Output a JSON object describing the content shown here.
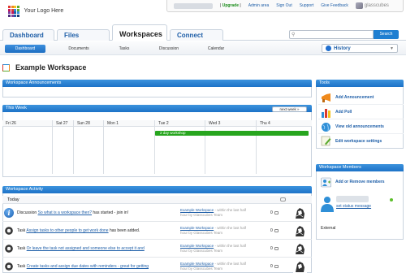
{
  "header": {
    "logo_text": "Your Logo Here",
    "upgrade_label": "Upgrade",
    "links": [
      "Admin area",
      "Sign Out",
      "Support",
      "Give Feedback"
    ],
    "brand": "glasscubes"
  },
  "tabs": [
    {
      "label": "Dashboard",
      "active": false
    },
    {
      "label": "Files",
      "active": false
    },
    {
      "label": "Workspaces",
      "active": true
    },
    {
      "label": "Connect",
      "active": false
    }
  ],
  "search": {
    "placeholder": "",
    "button_label": "Search"
  },
  "subnav": {
    "items": [
      {
        "label": "Dashboard",
        "active": true
      },
      {
        "label": "Documents",
        "active": false
      },
      {
        "label": "Tasks",
        "active": false
      },
      {
        "label": "Discussion",
        "active": false
      },
      {
        "label": "Calendar",
        "active": false
      }
    ],
    "history_label": "History"
  },
  "workspace": {
    "title": "Example Workspace"
  },
  "announcements": {
    "heading": "Workspace Announcements"
  },
  "this_week": {
    "heading": "This Week",
    "next_label": "next week »",
    "days": [
      "Fri 26",
      "Sat 27",
      "Sun 28",
      "Mon 1",
      "Tue 2",
      "Wed 3",
      "Thu 4"
    ],
    "event": "2 day workshop"
  },
  "activity": {
    "heading": "Workspace Activity",
    "group_label": "Today",
    "items": [
      {
        "icon": "info-icon",
        "type": "Discussion",
        "link": "So what is a workspace then?",
        "suffix": "has started - join in!",
        "source": "Example Workspace",
        "when": "- within the last half",
        "by": "hour by Glasscubes Team",
        "count": "0"
      },
      {
        "icon": "gear-icon",
        "type": "Task",
        "link": "Assign tasks to other people to get work done",
        "suffix": "has been added.",
        "source": "Example Workspace",
        "when": "- within the last half",
        "by": "hour by Glasscubes Team",
        "count": "0"
      },
      {
        "icon": "gear-icon",
        "type": "Task",
        "link": "Or leave the task not assigned and someone else to accept it and",
        "suffix": "",
        "source": "Example Workspace",
        "when": "- within the last half",
        "by": "hour by Glasscubes Team",
        "count": "0"
      },
      {
        "icon": "gear-icon",
        "type": "Task",
        "link": "Create tasks and assign due dates with reminders - great for getting",
        "suffix": "",
        "source": "Example Workspace",
        "when": "- within the last half",
        "by": "hour by Glasscubes Team",
        "count": "0"
      }
    ]
  },
  "tools": {
    "heading": "Tools",
    "items": [
      {
        "label": "Add Announcement",
        "icon": "megaphone-icon",
        "color": "#f08a1c"
      },
      {
        "label": "Add Poll",
        "icon": "poll-chart-icon",
        "color": "#d9362b"
      },
      {
        "label": "View old announcements",
        "icon": "globe-icon",
        "color": "#2f8fd7"
      },
      {
        "label": "Edit workspace settings",
        "icon": "edit-settings-icon",
        "color": "#5cab2f"
      }
    ]
  },
  "members": {
    "heading": "Workspace Members",
    "add_label": "Add or Remove members",
    "status_link": "set status message",
    "external_label": "External"
  }
}
